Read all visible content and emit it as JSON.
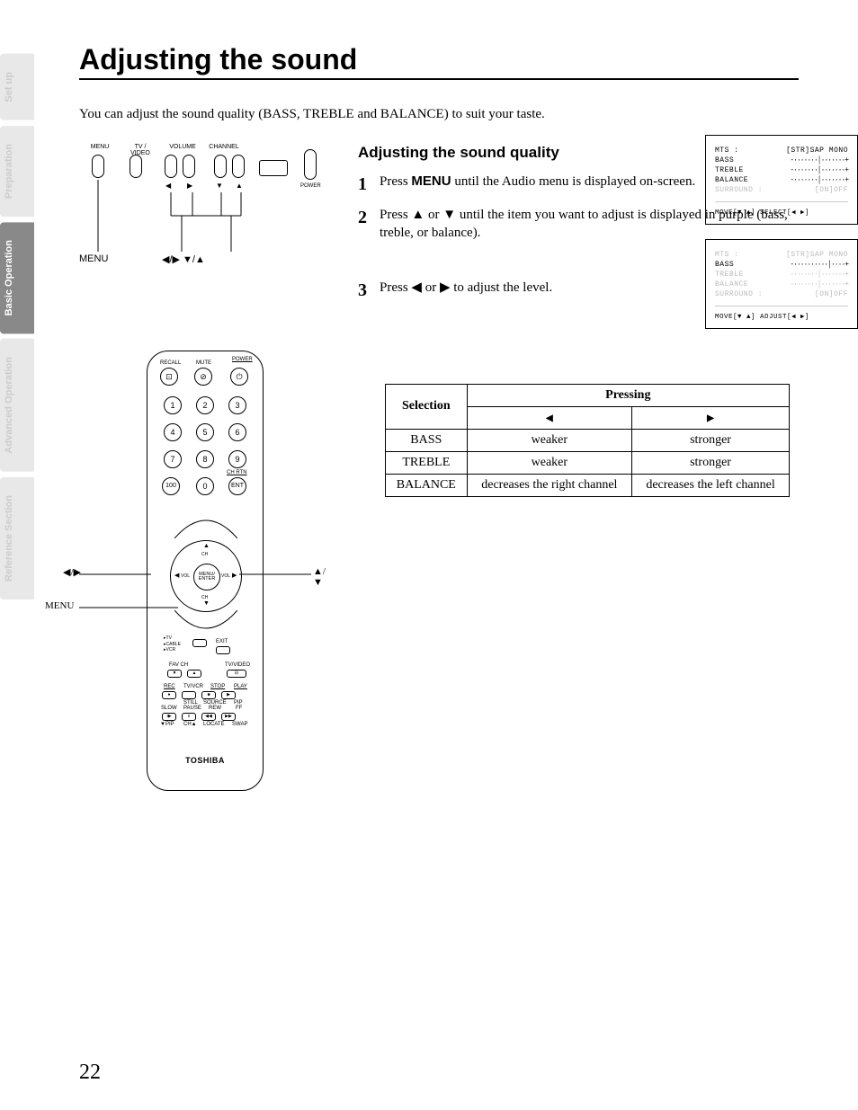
{
  "side_tabs": [
    "Set up",
    "Preparation",
    "Basic Operation",
    "Advanced Operation",
    "Reference Section"
  ],
  "active_tab_index": 2,
  "title": "Adjusting the sound",
  "intro": "You can adjust the sound quality (BASS, TREBLE and BALANCE) to suit your taste.",
  "tv_panel": {
    "labels": [
      "MENU",
      "TV / VIDEO",
      "VOLUME",
      "CHANNEL"
    ],
    "power_label": "POWER",
    "callout_menu": "MENU",
    "callout_arrows": "◀/▶   ▼/▲"
  },
  "subheading": "Adjusting the sound quality",
  "steps": [
    {
      "num": "1",
      "pre": "Press ",
      "bold": "MENU",
      "post": " until the Audio menu is displayed on-screen."
    },
    {
      "num": "2",
      "pre": "Press ▲ or ▼ until the item you want to adjust is displayed in purple (bass, treble, or balance).",
      "bold": "",
      "post": ""
    },
    {
      "num": "3",
      "pre": "Press ◀ or ▶ to adjust the level.",
      "bold": "",
      "post": ""
    }
  ],
  "osd1": {
    "rows": [
      {
        "k": "MTS :",
        "v": "[STR]SAP MONO",
        "dim": false
      },
      {
        "k": "BASS",
        "v": "-·······│·······+",
        "dim": false
      },
      {
        "k": "TREBLE",
        "v": "-·······│·······+",
        "dim": false
      },
      {
        "k": "BALANCE",
        "v": "-·······│·······+",
        "dim": false
      },
      {
        "k": "SURROUND :",
        "v": "[ON]OFF",
        "dim": true
      }
    ],
    "foot": "MOVE[▼ ▲]  SELECT[◀ ▶]"
  },
  "osd2": {
    "rows": [
      {
        "k": "MTS :",
        "v": "[STR]SAP MONO",
        "dim": true
      },
      {
        "k": "BASS",
        "v": "-··········│····+",
        "dim": false
      },
      {
        "k": "TREBLE",
        "v": "-·······│·······+",
        "dim": true
      },
      {
        "k": "BALANCE",
        "v": "-·······│·······+",
        "dim": true
      },
      {
        "k": "SURROUND :",
        "v": "[ON]OFF",
        "dim": true
      }
    ],
    "foot": "MOVE[▼ ▲]  ADJUST[◀ ▶]"
  },
  "table": {
    "h_selection": "Selection",
    "h_pressing": "Pressing",
    "h_left": "◀",
    "h_right": "▶",
    "rows": [
      {
        "sel": "BASS",
        "l": "weaker",
        "r": "stronger"
      },
      {
        "sel": "TREBLE",
        "l": "weaker",
        "r": "stronger"
      },
      {
        "sel": "BALANCE",
        "l": "decreases the right channel",
        "r": "decreases the left channel"
      }
    ]
  },
  "remote": {
    "top_labels": [
      "RECALL",
      "MUTE",
      "POWER"
    ],
    "digits": [
      "1",
      "2",
      "3",
      "4",
      "5",
      "6",
      "7",
      "8",
      "9",
      "100",
      "0",
      "ENT"
    ],
    "ch_rtn": "CH RTN",
    "dpad_center": "MENU/\nENTER",
    "dpad": {
      "up": "CH",
      "down": "CH",
      "left": "VOL",
      "right": "VOL"
    },
    "middle_rows": [
      [
        "TV",
        "CABLE",
        "VCR",
        "EXIT"
      ],
      [
        "FAV CH",
        "",
        "TV/VIDEO"
      ],
      [
        "REC",
        "TV/VCR",
        "STOP",
        "PLAY"
      ],
      [
        "SLOW",
        "STILL PAUSE",
        "SOURCE REW",
        "PIP FF"
      ],
      [
        "▼PIP",
        "CH▲",
        "LOCATE",
        "SWAP"
      ]
    ],
    "brand": "TOSHIBA",
    "callout_lr": "◀/▶",
    "callout_ud": "▲/▼",
    "callout_menu": "MENU"
  },
  "page_number": "22"
}
